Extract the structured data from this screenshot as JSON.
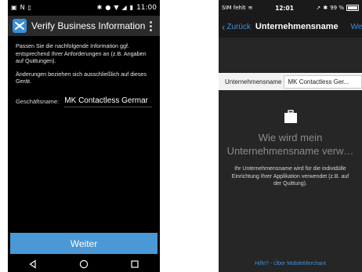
{
  "android": {
    "status_time": "11:00",
    "app_title": "Verify Business Information",
    "paragraph_1": "Passen Sie die nachfolgende Information ggf. entsprechend Ihrer Anforderungen an (z.B. Angaben auf Quittungen).",
    "paragraph_2": "Änderungen beziehen sich ausschließlich auf dieses Gerät.",
    "field_label": "Geschäftsname:",
    "field_value": "MK Contactless Germar",
    "button_label": "Weiter",
    "colors": {
      "toolbar": "#2b2b2b",
      "button": "#4a98d6",
      "background": "#000000"
    }
  },
  "ios": {
    "status_carrier": "SIM fehlt",
    "status_time": "12:01",
    "status_battery": "99 %",
    "back_label": "Zurück",
    "nav_title": "Unternehmensname",
    "nav_right": "Weite",
    "field_label": "Unternehmensname",
    "field_value": "MK Contactless Ger...",
    "empty_title_line1": "Wie wird mein",
    "empty_title_line2": "Unternehmensname verw…",
    "empty_description": "Ihr Unternehmensname wird für die individülle Einrichtung Ihrer Applikation verwendet (z.B. auf der Quittung).",
    "footer_link": "Hilfe? - Über MobileMerchant",
    "colors": {
      "accent": "#3f8fd8",
      "background": "#262626"
    }
  }
}
